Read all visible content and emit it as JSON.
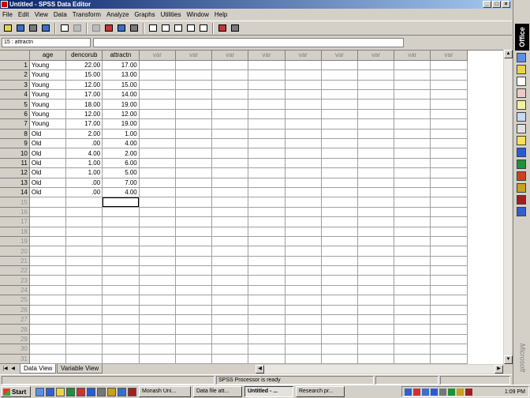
{
  "window": {
    "title": "Untitled - SPSS Data Editor"
  },
  "menu": [
    "File",
    "Edit",
    "View",
    "Data",
    "Transform",
    "Analyze",
    "Graphs",
    "Utilities",
    "Window",
    "Help"
  ],
  "cell_ref": "15 : attractn",
  "columns": [
    "age",
    "dencorub",
    "attractn",
    "var",
    "var",
    "var",
    "var",
    "var",
    "var",
    "var",
    "var",
    "var"
  ],
  "rows": [
    [
      "Young",
      "22.00",
      "17.00"
    ],
    [
      "Young",
      "15.00",
      "13.00"
    ],
    [
      "Young",
      "12.00",
      "15.00"
    ],
    [
      "Young",
      "17.00",
      "14.00"
    ],
    [
      "Young",
      "18.00",
      "19.00"
    ],
    [
      "Young",
      "12.00",
      "12.00"
    ],
    [
      "Young",
      "17.00",
      "19.00"
    ],
    [
      "Old",
      "2.00",
      "1.00"
    ],
    [
      "Old",
      ".00",
      "4.00"
    ],
    [
      "Old",
      "4.00",
      "2.00"
    ],
    [
      "Old",
      "1.00",
      "6.00"
    ],
    [
      "Old",
      "1.00",
      "5.00"
    ],
    [
      "Old",
      ".00",
      "7.00"
    ],
    [
      "Old",
      ".00",
      "4.00"
    ]
  ],
  "total_rows": 31,
  "selected_cell": {
    "row": 15,
    "column": "attractn"
  },
  "tabs": {
    "data_view": "Data View",
    "variable_view": "Variable View"
  },
  "status": {
    "processor": "SPSS Processor  is ready"
  },
  "office_bar": {
    "label": "Office",
    "vendor": "Microsoft"
  },
  "taskbar": {
    "start": "Start",
    "buttons": [
      "Monash Uni...",
      "Data file att...",
      "Untitled - ...",
      "Research pr..."
    ],
    "active_index": 2,
    "clock": "1:09 PM"
  },
  "window_buttons": [
    "_",
    "□",
    "×"
  ],
  "tab_nav": [
    "|◀",
    "◀",
    "▶",
    "▶|"
  ],
  "scroll_arrows": {
    "up": "▲",
    "down": "▼",
    "left": "◀",
    "right": "▶"
  }
}
